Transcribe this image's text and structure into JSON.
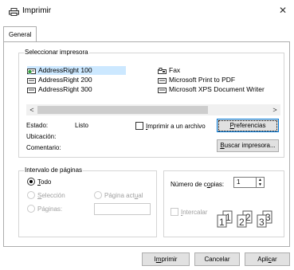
{
  "window": {
    "title": "Imprimir",
    "close_glyph": "✕"
  },
  "tabs": [
    {
      "label": "General"
    }
  ],
  "printer_group": {
    "legend": "Seleccionar impresora",
    "printers": [
      {
        "name": "AddressRight 100",
        "selected": true,
        "icon": "printer-default-icon"
      },
      {
        "name": "Fax",
        "icon": "fax-icon"
      },
      {
        "name": "AddressRight 200",
        "icon": "printer-icon"
      },
      {
        "name": "Microsoft Print to PDF",
        "icon": "printer-icon"
      },
      {
        "name": "AddressRight 300",
        "icon": "printer-icon"
      },
      {
        "name": "Microsoft XPS Document Writer",
        "icon": "printer-icon"
      }
    ],
    "scroll_left": "<",
    "scroll_right": ">",
    "status_label": "Estado:",
    "status_value": "Listo",
    "location_label": "Ubicación:",
    "comment_label": "Comentario:",
    "print_to_file": {
      "prefix": "",
      "accel": "I",
      "suffix": "mprimir a un archivo"
    },
    "preferences": {
      "prefix": "",
      "accel": "P",
      "suffix": "referencias"
    },
    "find_printer": {
      "prefix": "",
      "accel": "B",
      "suffix": "uscar impresora..."
    }
  },
  "range_group": {
    "legend": "Intervalo de páginas",
    "all": {
      "prefix": "",
      "accel": "T",
      "suffix": "odo"
    },
    "selection": {
      "prefix": "",
      "accel": "S",
      "suffix": "elección"
    },
    "current_page": {
      "prefix": "Página act",
      "accel": "u",
      "suffix": "al"
    },
    "pages": {
      "prefix": "Pá",
      "accel": "g",
      "suffix": "inas:"
    }
  },
  "copies": {
    "label": {
      "prefix": "Número de c",
      "accel": "o",
      "suffix": "pias:"
    },
    "value": "1",
    "collate": {
      "prefix": "",
      "accel": "I",
      "suffix": "ntercalar"
    }
  },
  "footer": {
    "print": {
      "prefix": "I",
      "accel": "m",
      "suffix": "primir"
    },
    "cancel": "Cancelar",
    "apply": {
      "prefix": "Apli",
      "accel": "c",
      "suffix": "ar"
    }
  },
  "colors": {
    "selection_bg": "#cce8ff",
    "default_button_border": "#0078d7",
    "button_bg": "#e1e1e1"
  }
}
